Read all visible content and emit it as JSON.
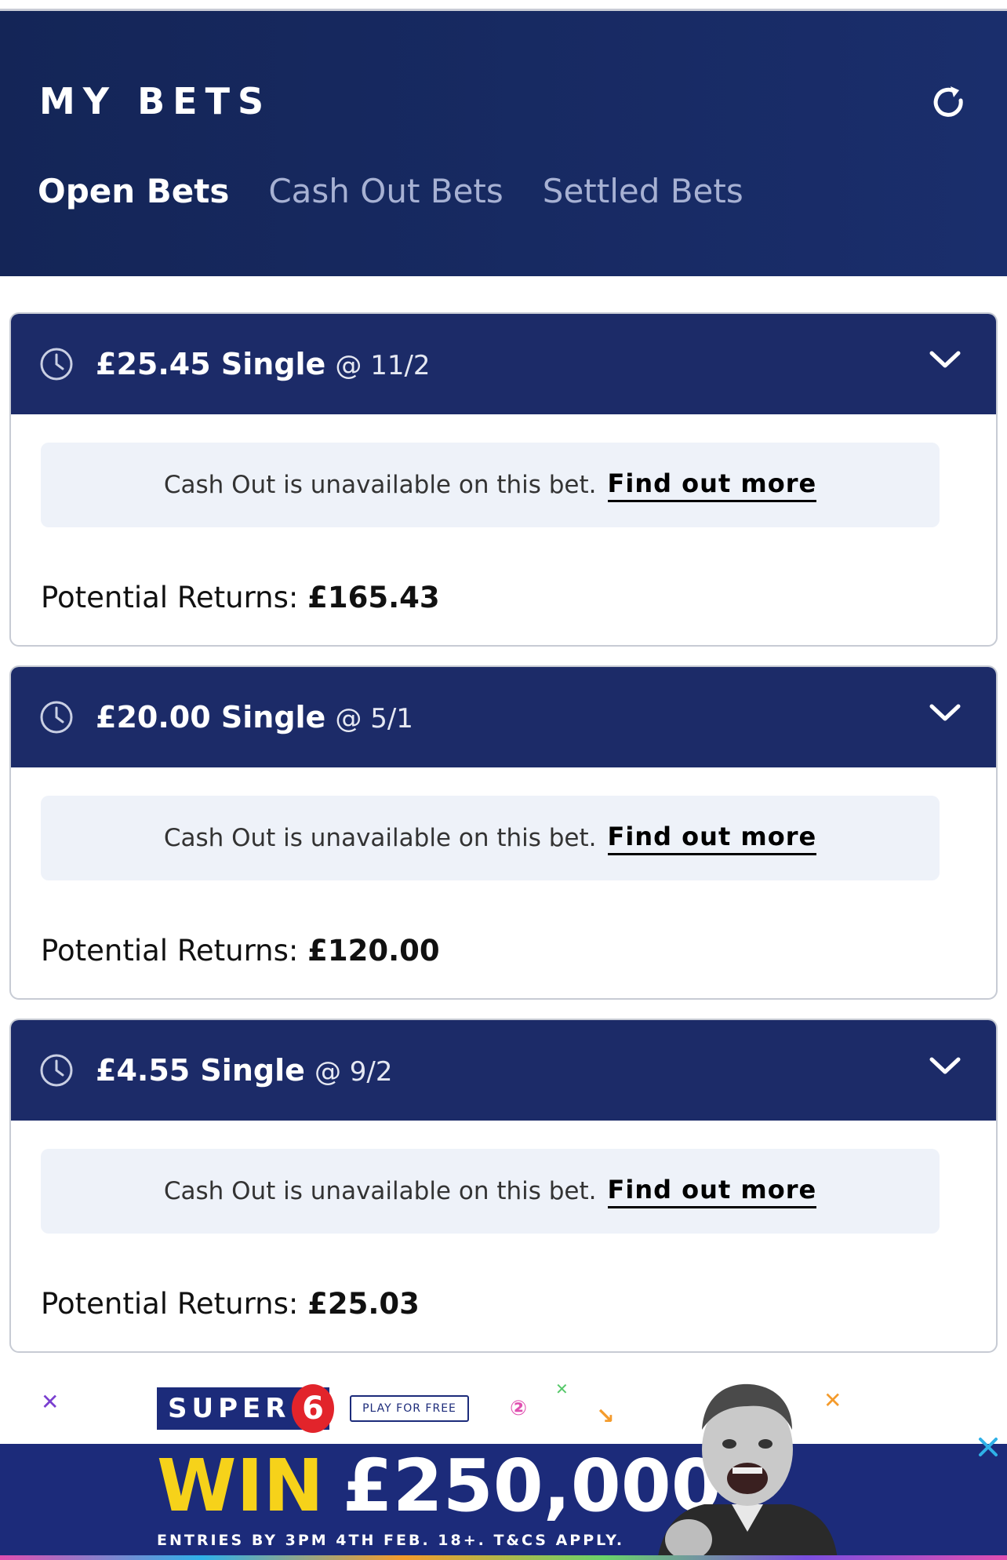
{
  "header": {
    "title": "MY BETS",
    "tabs": [
      {
        "label": "Open Bets",
        "active": true
      },
      {
        "label": "Cash Out Bets",
        "active": false
      },
      {
        "label": "Settled Bets",
        "active": false
      }
    ],
    "refresh_icon": "refresh-icon"
  },
  "bets": [
    {
      "stake": "£25.45 Single",
      "odds": "@ 11/2",
      "notice": "Cash Out is unavailable on this bet.",
      "link": "Find out more",
      "returns_label": "Potential Returns:",
      "returns": "£165.43"
    },
    {
      "stake": "£20.00 Single",
      "odds": "@ 5/1",
      "notice": "Cash Out is unavailable on this bet.",
      "link": "Find out more",
      "returns_label": "Potential Returns:",
      "returns": "£120.00"
    },
    {
      "stake": "£4.55 Single",
      "odds": "@ 9/2",
      "notice": "Cash Out is unavailable on this bet.",
      "link": "Find out more",
      "returns_label": "Potential Returns:",
      "returns": "£25.03"
    }
  ],
  "ad": {
    "brand": "SUPER",
    "brand_number": "6",
    "play_label": "PLAY FOR FREE",
    "win_word": "WIN",
    "prize": "£250,000",
    "small_print": "ENTRIES BY 3PM 4TH FEB. 18+. T&CS APPLY."
  },
  "colors": {
    "header_bg": "#142557",
    "bet_header_bg": "#1c2b68",
    "notice_bg": "#eef2f9",
    "ad_blue": "#1c2b7a",
    "ad_yellow": "#f6d21a"
  }
}
